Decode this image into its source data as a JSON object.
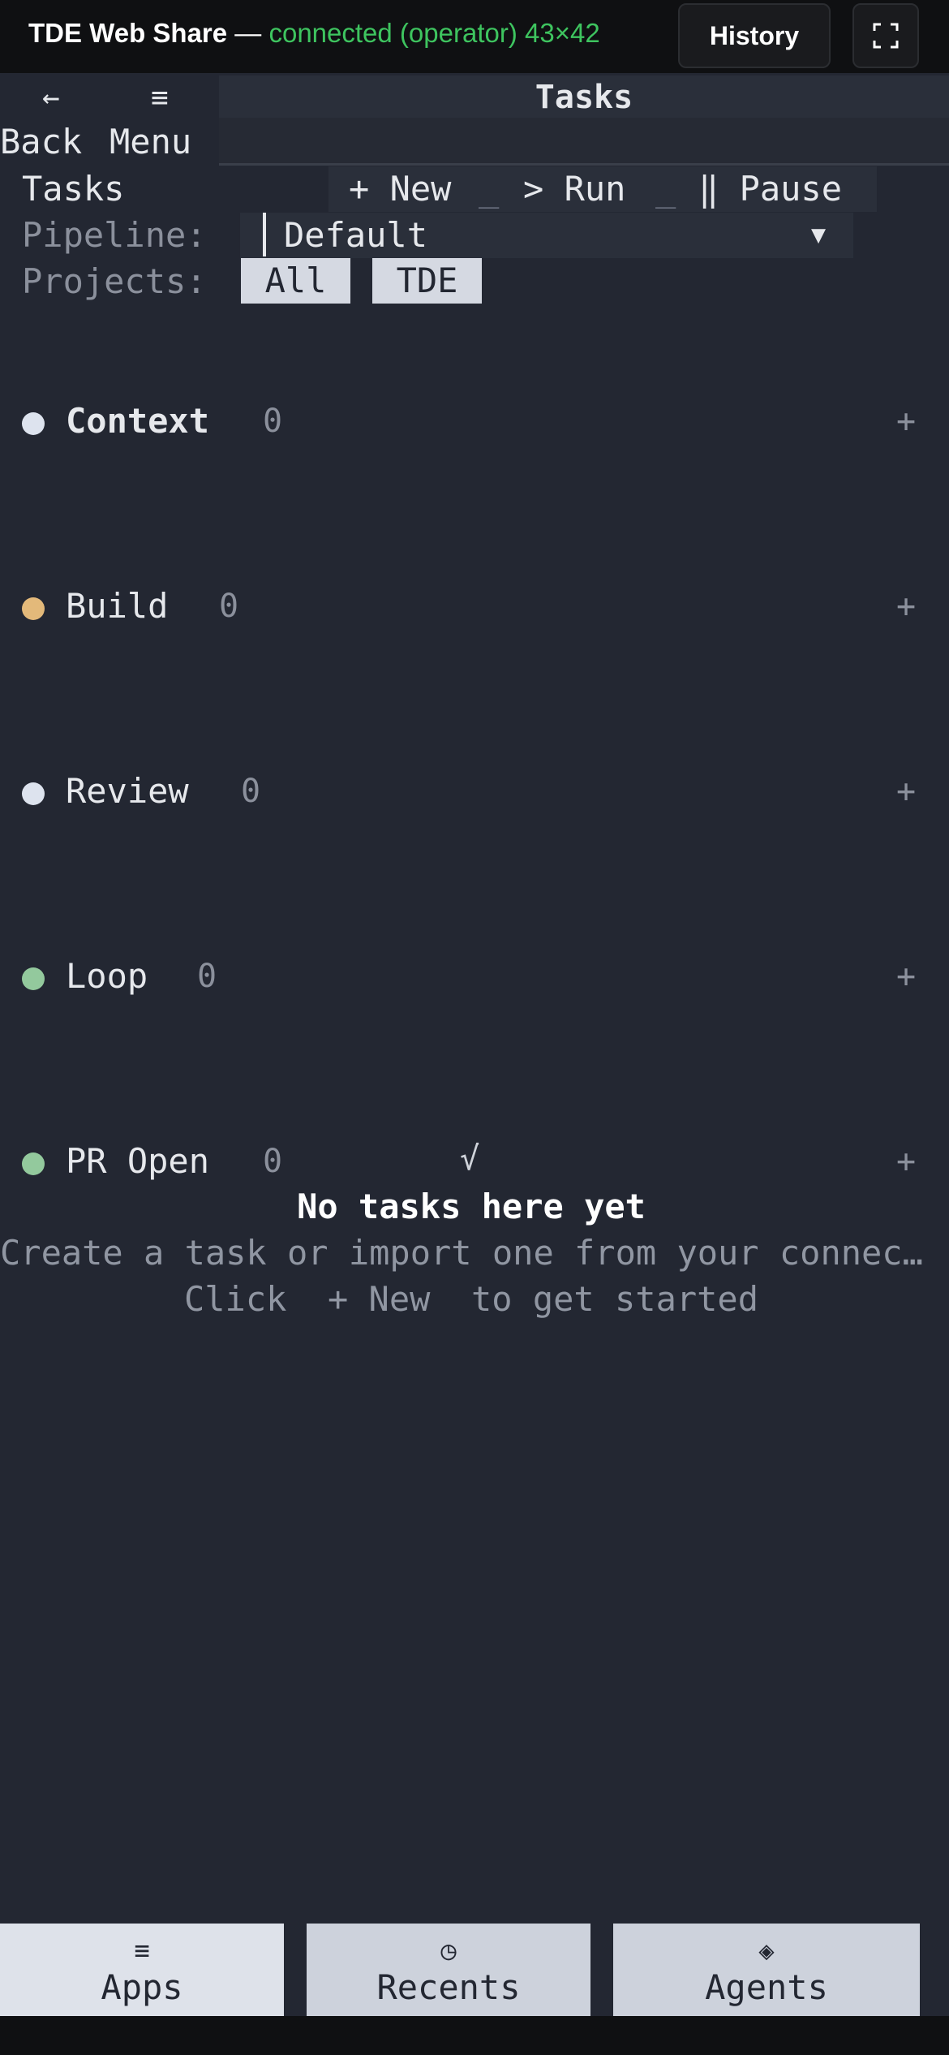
{
  "header": {
    "title": "TDE Web Share",
    "separator": " — ",
    "status": "connected (operator) 43×42",
    "history_label": "History",
    "fullscreen_icon": "fullscreen-icon"
  },
  "nav": {
    "back_glyph": "←",
    "menu_glyph": "≡",
    "back_label": "Back",
    "menu_label": "Menu",
    "screen_title": "Tasks"
  },
  "toolbar": {
    "section_label": "Tasks",
    "new_label": "+ New",
    "run_label": "> Run",
    "pause_label": "‖ Pause",
    "underscore": "_"
  },
  "filters": {
    "pipeline_label": "Pipeline:",
    "pipeline_value": "Default",
    "dropdown_arrow": "▼",
    "projects_label": "Projects:",
    "projects": [
      "All",
      "TDE"
    ]
  },
  "columns": [
    {
      "name": "Context",
      "count": "0",
      "color": "#dde3ee",
      "bold": true
    },
    {
      "name": "Build",
      "count": "0",
      "color": "#e3b97a",
      "bold": false
    },
    {
      "name": "Review",
      "count": "0",
      "color": "#dde3ee",
      "bold": false
    },
    {
      "name": "Loop",
      "count": "0",
      "color": "#93c99d",
      "bold": false
    },
    {
      "name": "PR Open",
      "count": "0",
      "color": "#93c99d",
      "bold": false
    }
  ],
  "add_glyph": "+",
  "check_glyph": "√",
  "empty_state": {
    "title": "No tasks here yet",
    "description": "Create a task or import one from your connectors.",
    "hint": "Click  + New  to get started"
  },
  "bottom_tabs": [
    {
      "glyph": "≡",
      "label": "Apps"
    },
    {
      "glyph": "◷",
      "label": "Recents"
    },
    {
      "glyph": "◈",
      "label": "Agents"
    }
  ],
  "colors": {
    "background": "#232732",
    "status_green": "#3ec45f",
    "chip_bg": "#d5d9e2"
  }
}
